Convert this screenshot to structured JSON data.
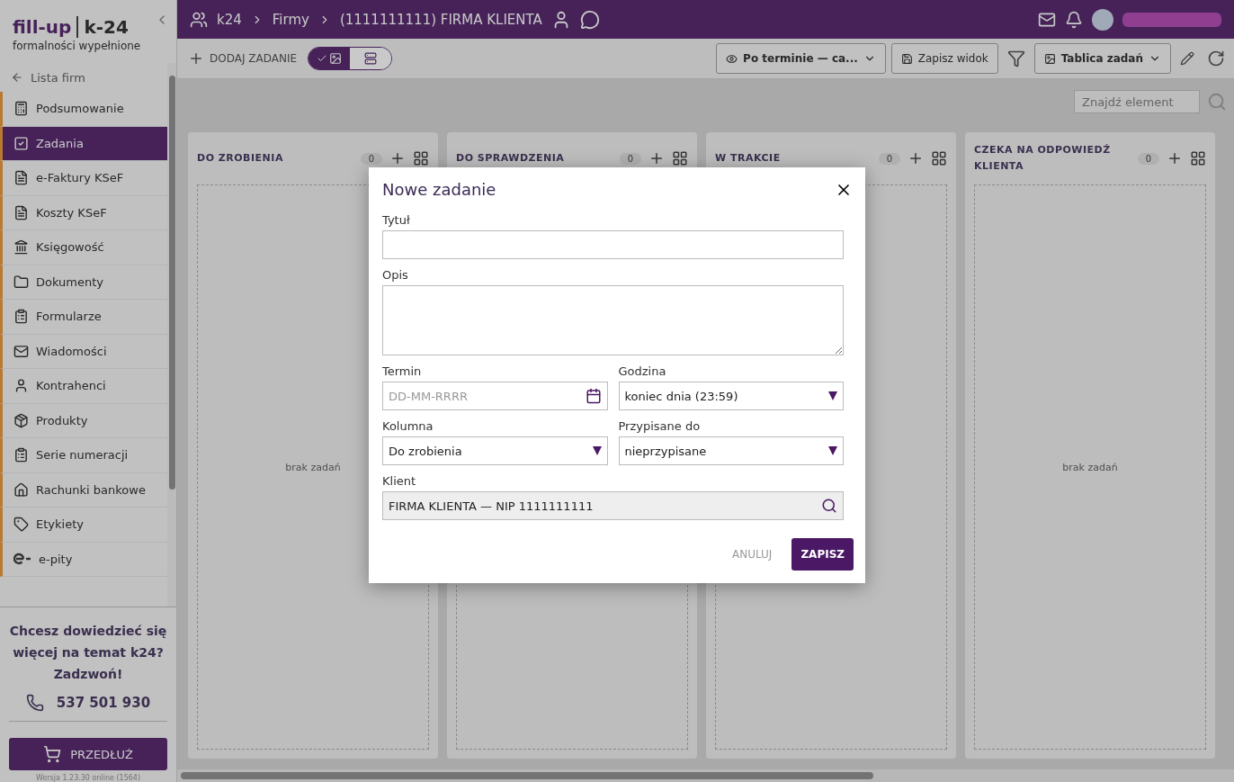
{
  "sidebar": {
    "logo": {
      "left": "fill-up",
      "right": "k-24",
      "tagline": "formalności wypełnione"
    },
    "back_link": "Lista firm",
    "items": [
      {
        "label": "Podsumowanie",
        "selected": false
      },
      {
        "label": "Zadania",
        "selected": true
      },
      {
        "label": "e-Faktury KSeF",
        "selected": false
      },
      {
        "label": "Koszty KSeF",
        "selected": false
      },
      {
        "label": "Księgowość",
        "selected": false
      },
      {
        "label": "Dokumenty",
        "selected": false
      },
      {
        "label": "Formularze",
        "selected": false
      },
      {
        "label": "Wiadomości",
        "selected": false
      },
      {
        "label": "Kontrahenci",
        "selected": false
      },
      {
        "label": "Produkty",
        "selected": false
      },
      {
        "label": "Serie numeracji",
        "selected": false
      },
      {
        "label": "Rachunki bankowe",
        "selected": false
      },
      {
        "label": "Etykiety",
        "selected": false
      },
      {
        "label": "e-pity",
        "selected": false
      }
    ],
    "promo": {
      "text": "Chcesz dowiedzieć się więcej na temat k24? Zadzwoń!",
      "phone": "537 501 930"
    },
    "renew_button": "PRZEDŁUŻ",
    "version": "Wersja 1.23.30 online (1564)"
  },
  "breadcrumbs": [
    "k24",
    "Firmy",
    "(1111111111) FIRMA KLIENTA"
  ],
  "toolbar": {
    "add_task": "DODAJ ZADANIE",
    "view_toggle": [
      {
        "kind": "board",
        "selected": true
      },
      {
        "kind": "list",
        "selected": false
      }
    ],
    "sort_select": "Po terminie — ca...",
    "save_view": "Zapisz widok",
    "board_select": "Tablica zadań"
  },
  "search": {
    "placeholder": "Znajdź element"
  },
  "columns": [
    {
      "title": "DO ZROBIENIA",
      "count": "0",
      "empty_text": "brak zadań"
    },
    {
      "title": "DO SPRAWDZENIA",
      "count": "0"
    },
    {
      "title": "W TRAKCIE",
      "count": "0"
    },
    {
      "title": "CZEKA NA ODPOWIEDŹ KLIENTA",
      "count": "0",
      "empty_text": "brak zadań"
    }
  ],
  "dialog": {
    "title": "Nowe zadanie",
    "fields": [
      {
        "label": "Tytuł",
        "kind": "text"
      },
      {
        "label": "Opis",
        "kind": "textarea"
      },
      {
        "label": "Termin",
        "kind": "date",
        "placeholder": "DD-MM-RRRR"
      },
      {
        "label": "Godzina",
        "kind": "select",
        "value": "koniec dnia (23:59)"
      },
      {
        "label": "Kolumna",
        "kind": "select",
        "value": "Do zrobienia"
      },
      {
        "label": "Przypisane do",
        "kind": "select",
        "value": "nieprzypisane"
      },
      {
        "label": "Klient",
        "kind": "lookup",
        "value": "FIRMA KLIENTA — NIP 1111111111"
      }
    ],
    "cancel": "ANULUJ",
    "save": "ZAPISZ"
  }
}
